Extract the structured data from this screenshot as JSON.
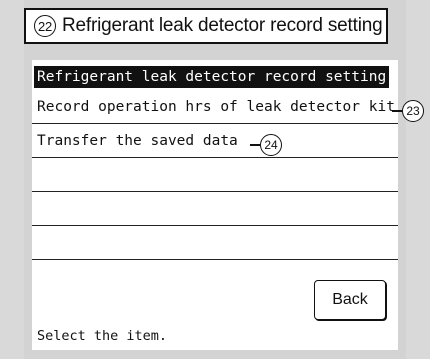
{
  "title": {
    "number": "22",
    "text": "Refrigerant leak detector record setting"
  },
  "screen": {
    "header": "Refrigerant leak detector record setting",
    "items": [
      {
        "label": "Record operation hrs of leak detector kit",
        "callout": "23"
      },
      {
        "label": "Transfer the saved data",
        "callout": "24"
      },
      {
        "label": ""
      },
      {
        "label": ""
      },
      {
        "label": ""
      }
    ],
    "back_label": "Back",
    "status": "Select the item."
  }
}
